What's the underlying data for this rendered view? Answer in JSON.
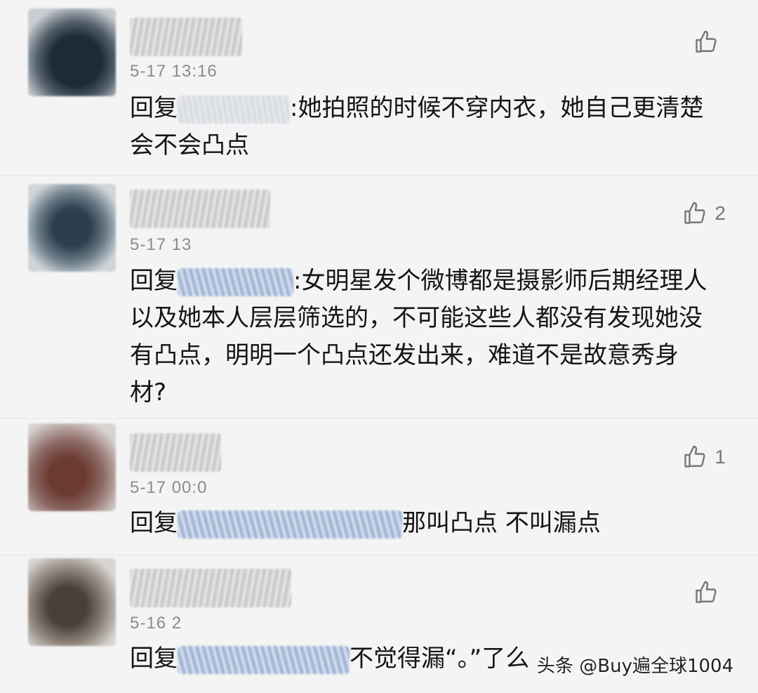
{
  "comments": [
    {
      "timestamp": "5-17 13:16",
      "reply_prefix": "回复",
      "reply_text": ":她拍照的时候不穿内衣，她自己更清楚会不会凸点",
      "like_count": ""
    },
    {
      "timestamp": "5-17 13",
      "reply_prefix": "回复",
      "reply_text": ":女明星发个微博都是摄影师后期经理人以及她本人层层筛选的，不可能这些人都没有发现她没有凸点，明明一个凸点还发出来，难道不是故意秀身材?",
      "like_count": "2"
    },
    {
      "timestamp": "5-17 00:0",
      "reply_prefix": "回复",
      "reply_text": "那叫凸点 不叫漏点",
      "like_count": "1"
    },
    {
      "timestamp": "5-16 2",
      "reply_prefix": "回复",
      "reply_text": "不觉得漏“。”了么",
      "like_count": ""
    }
  ],
  "watermark": "头条 @Buy遍全球1004",
  "icons": {
    "like": "thumbs-up-icon"
  },
  "colors": {
    "text": "#151515",
    "meta": "#8b8b8b",
    "icon": "#777777"
  }
}
